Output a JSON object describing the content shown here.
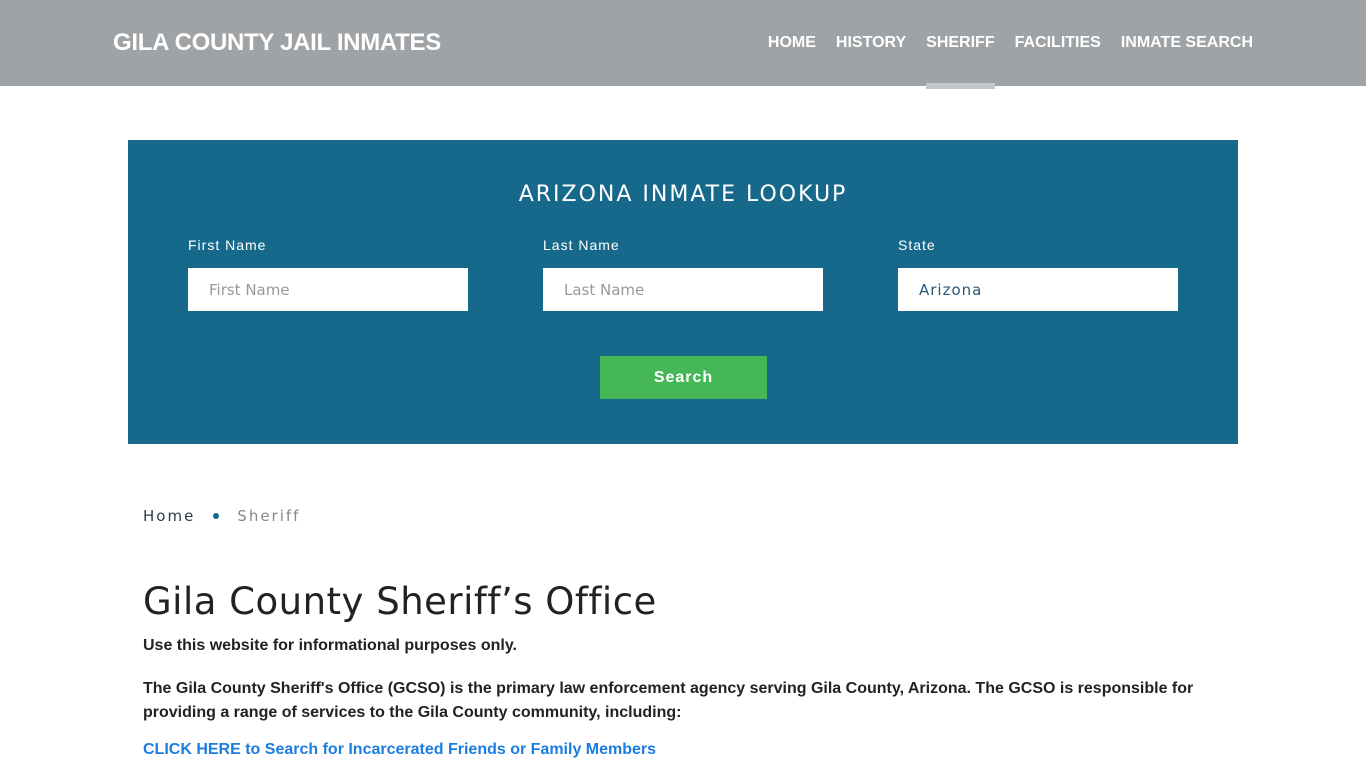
{
  "header": {
    "brand": "GILA COUNTY JAIL INMATES",
    "nav": [
      {
        "label": "HOME",
        "active": false
      },
      {
        "label": "HISTORY",
        "active": false
      },
      {
        "label": "SHERIFF",
        "active": true
      },
      {
        "label": "FACILITIES",
        "active": false
      },
      {
        "label": "INMATE SEARCH",
        "active": false
      }
    ]
  },
  "lookup": {
    "title": "ARIZONA INMATE LOOKUP",
    "first_name": {
      "label": "First Name",
      "placeholder": "First Name",
      "value": ""
    },
    "last_name": {
      "label": "Last Name",
      "placeholder": "Last Name",
      "value": ""
    },
    "state": {
      "label": "State",
      "value": "Arizona"
    },
    "search_label": "Search",
    "colors": {
      "panel": "#17698c",
      "button": "#46b756"
    }
  },
  "breadcrumb": {
    "home": "Home",
    "current": "Sheriff"
  },
  "content": {
    "title": "Gila County Sheriff’s Office",
    "notice": "Use this website for informational purposes only.",
    "intro": "The Gila County Sheriff's Office (GCSO) is the primary law enforcement agency serving Gila County, Arizona. The GCSO is responsible for providing a range of services to the Gila County community, including:",
    "cta_link": "CLICK HERE to Search for Incarcerated Friends or Family Members"
  }
}
